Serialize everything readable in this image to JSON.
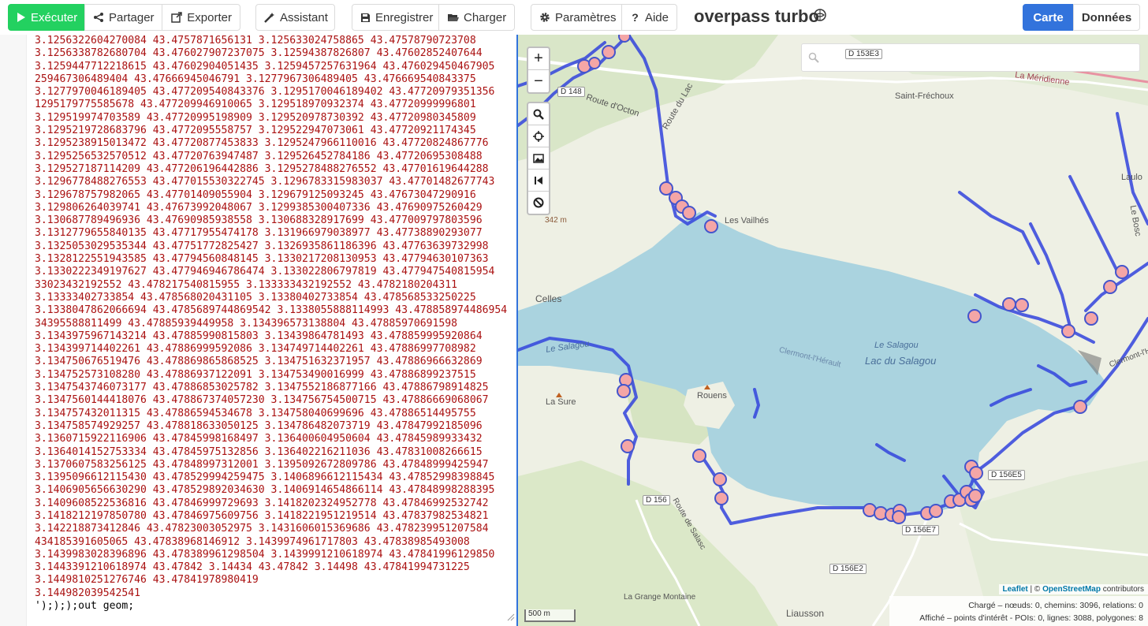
{
  "toolbar": {
    "run_label": "Exécuter",
    "share_label": "Partager",
    "export_label": "Exporter",
    "wizard_label": "Assistant",
    "save_label": "Enregistrer",
    "load_label": "Charger",
    "settings_label": "Paramètres",
    "help_label": "Aide",
    "app_title": "overpass turbo",
    "tab_map": "Carte",
    "tab_data": "Données"
  },
  "editor": {
    "lines": [
      "3.1256322604270084 43.4757871656131 3.125633024758865 43.47578790723708",
      "3.1256338782680704 43.476027907237075 3.12594387826807 43.47602852407644",
      "3.1259447712218615 43.47602904051435 3.1259457257631964 43.476029450467905",
      "259467306489404 43.47666945046791 3.1277967306489405 43.476669540843375",
      "3.1277970046189405 43.477209540843376 3.1295170046189402 43.47720979351356",
      "1295179775585678 43.477209946910065 3.129518970932374 43.47720999996801",
      "3.129519974703589 43.47720995198909 3.129520978730392 43.47720980345809",
      "3.1295219728683796 43.4772095558757 3.129522947073061 43.47720921174345",
      "3.1295238915013472 43.47720877453833 3.1295247966110016 43.47720824867776",
      "3.1295256532570512 43.47720763947487 3.129526452784186 43.47720695308488",
      "3.129527187114209 43.477206196442886 3.1295278488276552 43.47701619644288",
      "3.1296778488276553 43.477015530322745 3.1296783315983037 43.47701482677743",
      "3.129678757982065 43.47701409055904 3.129679125093245 43.47673047290916",
      "3.129806264039741 43.47673992048067 3.1299385300407336 43.47690975260429",
      "3.130687789496936 43.47690985938558 3.130688328917699 43.477009797803596",
      "3.1312779655840135 43.47717955474178 3.131966979038977 43.47738890293077",
      "3.1325053029535344 43.47751772825427 3.1326935861186396 43.47763639732998",
      "3.1328122551943585 43.47794560848145 3.1330217208130953 43.47794630107363",
      "3.1330222349197627 43.477946946786474 3.133022806797819 43.477947540815954",
      "33023432192552 43.478217540815955 3.133333432192552 43.4782180204311",
      "3.13333402733854 43.478568020431105 3.13380402733854 43.478568533250225",
      "3.1338047862066694 43.4785689744869542 3.1338055888114993 43.478858974486954",
      "34395588811499 43.47885939449958 3.134396573138804 43.47885970691598",
      "3.1343975967143214 43.47885990815803 3.13439864781493 43.478859995920864",
      "3.134399714402261 43.47886999592086 3.134749714402261 43.47886997708982",
      "3.134750676519476 43.478869865868525 3.134751632371957 43.47886966632869",
      "3.134752573108280 43.47886937122091 3.134753490016999 43.47886899237515",
      "3.1347543746073177 43.47886853025782 3.1347552186877166 43.47886798914825",
      "3.1347560144418076 43.478867374057230 3.134756754500715 43.47886669068067",
      "3.134757432011315 43.47886594534678 3.134758040699696 43.47886514495755",
      "3.134758574929257 43.478818633050125 3.134786482073719 43.47847992185096",
      "3.1360715922116906 43.47845998168497 3.136400604950604 43.47845989933432",
      "3.1364014152753334 43.47845975132856 3.136402216211036 43.47831008266615",
      "3.1370607583256125 43.47848997312001 3.1395092672809786 43.47848999425947",
      "3.1395096612115430 43.478529994259475 3.1406896612115434 43.47852998398845",
      "3.1406905656630290 43.478529892034630 3.1406914654866114 43.47848998288395",
      "3.1409608522536816 43.47846999729693 3.1418202324952778 43.47846992532742",
      "3.1418212197850780 43.47846975609756 3.1418221951219514 43.47837982534821",
      "3.142218873412846 43.47823003052975 3.1431606015369686 43.478239951207584",
      "434185391605065 43.47838968146912 3.1439974961717803 43.47838985493008",
      "3.1439983028396896 43.478389961298504 3.1439991210618974 43.47841996129850",
      "3.1443391210618974 43.47842 3.14434 43.47842 3.14498 43.47841994731225",
      "3.1449810251276746 43.47841978980419",
      "3.144982039542541",
      "');););out geom;"
    ]
  },
  "map": {
    "search_placeholder": "",
    "labels": {
      "route_du_lac": "Route du Lac",
      "route_octon": "Route d'Octon",
      "saint_frechoux": "Saint-Fréchoux",
      "la_meridienne": "La Méridienne",
      "laulo": "Laulo",
      "le_bosc": "Le Bosc",
      "les_vailhes": "Les Vailhés",
      "altitude": "342 m",
      "celles": "Celles",
      "le_salagou": "Le Salagou",
      "clermont_herault": "Clermont-l'Hérault",
      "lac_du_salagou": "Lac du Salagou",
      "la_sure": "La Sure",
      "rouens": "Rouens",
      "route_salasc": "Route de Salasc",
      "la_grange_montaine": "La Grange Montaine",
      "liausson": "Liausson",
      "d148": "D 148",
      "d153e3": "D 153E3",
      "d156": "D 156",
      "d156e5": "D 156E5",
      "d156e7": "D 156E7",
      "d156e2": "D 156E2"
    },
    "scale_label": "500 m",
    "attribution_leaflet": "Leaflet",
    "attribution_sep": " | © ",
    "attribution_osm": "OpenStreetMap",
    "attribution_tail": " contributors",
    "stats_loaded": "Chargé – nœuds: 0, chemins: 3096, relations: 0",
    "stats_shown": "Affiché – points d'intérêt - POIs: 0, lignes: 3088, polygones: 8"
  },
  "colors": {
    "run_green": "#23d160",
    "tab_blue": "#3273dc",
    "code_red": "#aa1111",
    "lake_blue": "#aad3df",
    "route_blue": "#3344dd",
    "poi_fill": "#f4a6a6"
  }
}
